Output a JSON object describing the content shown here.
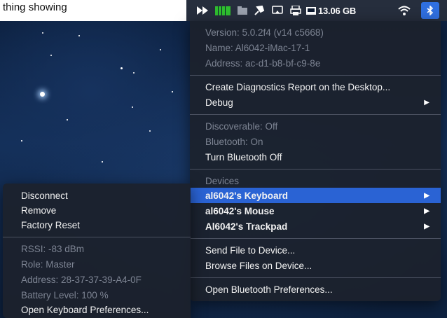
{
  "corner_text": "thing showing",
  "menubar": {
    "storage": "13.06 GB",
    "bluetooth_icon": "bluetooth-icon"
  },
  "main_menu": {
    "version": "Version: 5.0.2f4 (v14 c5668)",
    "name": "Name: Al6042-iMac-17-1",
    "address": "Address: ac-d1-b8-bf-c9-8e",
    "create_report": "Create Diagnostics Report on the Desktop...",
    "debug": "Debug",
    "discoverable": "Discoverable: Off",
    "bluetooth_status": "Bluetooth: On",
    "turn_off": "Turn Bluetooth Off",
    "devices_header": "Devices",
    "devices": [
      "al6042's Keyboard",
      "al6042's Mouse",
      "Al6042's Trackpad"
    ],
    "send_file": "Send File to Device...",
    "browse_files": "Browse Files on Device...",
    "open_prefs": "Open Bluetooth Preferences..."
  },
  "sub_menu": {
    "disconnect": "Disconnect",
    "remove": "Remove",
    "factory_reset": "Factory Reset",
    "rssi": "RSSI: -83 dBm",
    "role": "Role: Master",
    "address": "Address: 28-37-37-39-A4-0F",
    "battery": "Battery Level: 100 %",
    "open_keyboard_prefs": "Open Keyboard Preferences..."
  },
  "colors": {
    "highlight": "#2a63d4",
    "menu_bg": "#1c212c",
    "accent": "#2f6fe0"
  }
}
